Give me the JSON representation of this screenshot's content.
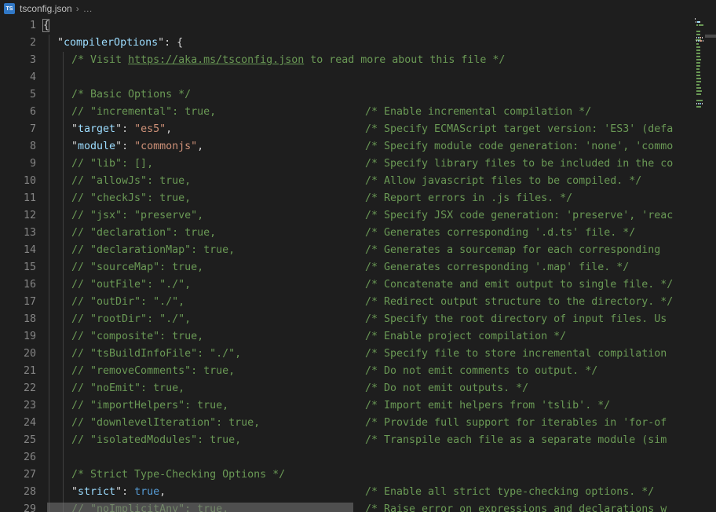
{
  "breadcrumb": {
    "file_icon_label": "TS",
    "file": "tsconfig.json",
    "separator": "›",
    "dots": "…"
  },
  "colors": {
    "background": "#1e1e1e",
    "comment": "#6a9955",
    "key": "#9cdcfe",
    "string": "#ce9178",
    "boolean": "#569cd6",
    "punctuation": "#d4d4d4",
    "line_number": "#858585",
    "indent_guide": "#404040",
    "ts_badge": "#3178c6",
    "scrollbar_thumb": "#797979"
  },
  "editor": {
    "language": "json",
    "first_visible_line": 1,
    "last_visible_line": 29,
    "lines": [
      {
        "n": 1,
        "indent": 0,
        "code": [
          {
            "t": "pun",
            "s": "{"
          }
        ],
        "comment": "",
        "cursor_bracket": true
      },
      {
        "n": 2,
        "indent": 1,
        "code": [
          {
            "t": "pun",
            "s": "\""
          },
          {
            "t": "key",
            "s": "compilerOptions"
          },
          {
            "t": "pun",
            "s": "\": {"
          }
        ],
        "comment": ""
      },
      {
        "n": 3,
        "indent": 2,
        "code": [
          {
            "t": "cmt",
            "s": "/* Visit "
          },
          {
            "t": "lnk",
            "s": "https://aka.ms/tsconfig.json"
          },
          {
            "t": "cmt",
            "s": " to read more about this file */"
          }
        ],
        "comment": ""
      },
      {
        "n": 4,
        "indent": 0,
        "code": [],
        "comment": ""
      },
      {
        "n": 5,
        "indent": 2,
        "code": [
          {
            "t": "cmt",
            "s": "/* Basic Options */"
          }
        ],
        "comment": ""
      },
      {
        "n": 6,
        "indent": 2,
        "code": [
          {
            "t": "cmt",
            "s": "// \"incremental\": true,"
          }
        ],
        "comment": "/* Enable incremental compilation */"
      },
      {
        "n": 7,
        "indent": 2,
        "code": [
          {
            "t": "pun",
            "s": "\""
          },
          {
            "t": "key",
            "s": "target"
          },
          {
            "t": "pun",
            "s": "\": "
          },
          {
            "t": "str",
            "s": "\"es5\""
          },
          {
            "t": "pun",
            "s": ","
          }
        ],
        "comment": "/* Specify ECMAScript target version: 'ES3' (defa"
      },
      {
        "n": 8,
        "indent": 2,
        "code": [
          {
            "t": "pun",
            "s": "\""
          },
          {
            "t": "key",
            "s": "module"
          },
          {
            "t": "pun",
            "s": "\": "
          },
          {
            "t": "str",
            "s": "\"commonjs\""
          },
          {
            "t": "pun",
            "s": ","
          }
        ],
        "comment": "/* Specify module code generation: 'none', 'commo"
      },
      {
        "n": 9,
        "indent": 2,
        "code": [
          {
            "t": "cmt",
            "s": "// \"lib\": [],"
          }
        ],
        "comment": "/* Specify library files to be included in the co"
      },
      {
        "n": 10,
        "indent": 2,
        "code": [
          {
            "t": "cmt",
            "s": "// \"allowJs\": true,"
          }
        ],
        "comment": "/* Allow javascript files to be compiled. */"
      },
      {
        "n": 11,
        "indent": 2,
        "code": [
          {
            "t": "cmt",
            "s": "// \"checkJs\": true,"
          }
        ],
        "comment": "/* Report errors in .js files. */"
      },
      {
        "n": 12,
        "indent": 2,
        "code": [
          {
            "t": "cmt",
            "s": "// \"jsx\": \"preserve\","
          }
        ],
        "comment": "/* Specify JSX code generation: 'preserve', 'reac"
      },
      {
        "n": 13,
        "indent": 2,
        "code": [
          {
            "t": "cmt",
            "s": "// \"declaration\": true,"
          }
        ],
        "comment": "/* Generates corresponding '.d.ts' file. */"
      },
      {
        "n": 14,
        "indent": 2,
        "code": [
          {
            "t": "cmt",
            "s": "// \"declarationMap\": true,"
          }
        ],
        "comment": "/* Generates a sourcemap for each corresponding "
      },
      {
        "n": 15,
        "indent": 2,
        "code": [
          {
            "t": "cmt",
            "s": "// \"sourceMap\": true,"
          }
        ],
        "comment": "/* Generates corresponding '.map' file. */"
      },
      {
        "n": 16,
        "indent": 2,
        "code": [
          {
            "t": "cmt",
            "s": "// \"outFile\": \"./\","
          }
        ],
        "comment": "/* Concatenate and emit output to single file. */"
      },
      {
        "n": 17,
        "indent": 2,
        "code": [
          {
            "t": "cmt",
            "s": "// \"outDir\": \"./\","
          }
        ],
        "comment": "/* Redirect output structure to the directory. */"
      },
      {
        "n": 18,
        "indent": 2,
        "code": [
          {
            "t": "cmt",
            "s": "// \"rootDir\": \"./\","
          }
        ],
        "comment": "/* Specify the root directory of input files. Us"
      },
      {
        "n": 19,
        "indent": 2,
        "code": [
          {
            "t": "cmt",
            "s": "// \"composite\": true,"
          }
        ],
        "comment": "/* Enable project compilation */"
      },
      {
        "n": 20,
        "indent": 2,
        "code": [
          {
            "t": "cmt",
            "s": "// \"tsBuildInfoFile\": \"./\","
          }
        ],
        "comment": "/* Specify file to store incremental compilation"
      },
      {
        "n": 21,
        "indent": 2,
        "code": [
          {
            "t": "cmt",
            "s": "// \"removeComments\": true,"
          }
        ],
        "comment": "/* Do not emit comments to output. */"
      },
      {
        "n": 22,
        "indent": 2,
        "code": [
          {
            "t": "cmt",
            "s": "// \"noEmit\": true,"
          }
        ],
        "comment": "/* Do not emit outputs. */"
      },
      {
        "n": 23,
        "indent": 2,
        "code": [
          {
            "t": "cmt",
            "s": "// \"importHelpers\": true,"
          }
        ],
        "comment": "/* Import emit helpers from 'tslib'. */"
      },
      {
        "n": 24,
        "indent": 2,
        "code": [
          {
            "t": "cmt",
            "s": "// \"downlevelIteration\": true,"
          }
        ],
        "comment": "/* Provide full support for iterables in 'for-of"
      },
      {
        "n": 25,
        "indent": 2,
        "code": [
          {
            "t": "cmt",
            "s": "// \"isolatedModules\": true,"
          }
        ],
        "comment": "/* Transpile each file as a separate module (sim"
      },
      {
        "n": 26,
        "indent": 0,
        "code": [],
        "comment": ""
      },
      {
        "n": 27,
        "indent": 2,
        "code": [
          {
            "t": "cmt",
            "s": "/* Strict Type-Checking Options */"
          }
        ],
        "comment": ""
      },
      {
        "n": 28,
        "indent": 2,
        "code": [
          {
            "t": "pun",
            "s": "\""
          },
          {
            "t": "key",
            "s": "strict"
          },
          {
            "t": "pun",
            "s": "\": "
          },
          {
            "t": "bool",
            "s": "true"
          },
          {
            "t": "pun",
            "s": ","
          }
        ],
        "comment": "/* Enable all strict type-checking options. */"
      },
      {
        "n": 29,
        "indent": 2,
        "code": [
          {
            "t": "cmt",
            "s": "// \"noImplicitAny\": true,"
          }
        ],
        "comment": "/* Raise error on expressions and declarations w"
      }
    ]
  },
  "minimap": {
    "visible": true,
    "rendered_lines": 29
  },
  "scrollbars": {
    "vertical_visible": true,
    "horizontal_visible": true
  }
}
